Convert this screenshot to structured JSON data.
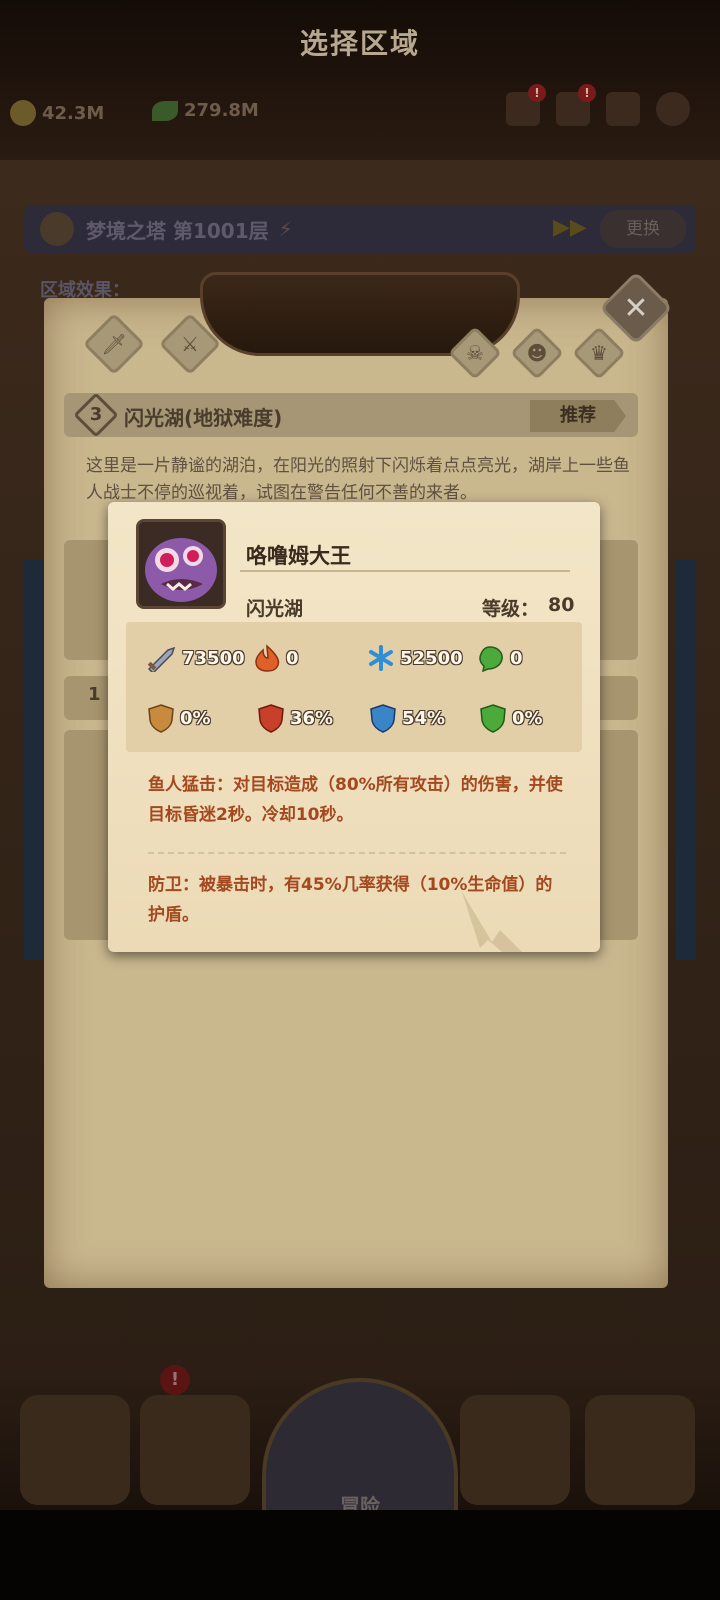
{
  "resources": {
    "gold": "42.3M",
    "leaf": "279.8M"
  },
  "tower": {
    "title": "梦境之塔 第1001层",
    "change": "更换",
    "region_effect": "区域效果："
  },
  "panel": {
    "title": "选择区域",
    "region": {
      "number": "3",
      "name": "闪光湖(地狱难度)",
      "recommend": "推荐",
      "description": "这里是一片静谧的湖泊，在阳光的照射下闪烁着点点亮光，湖岸上一些鱼人战士不停的巡视着，试图在警告任何不善的来者。"
    },
    "second_region_number": "1"
  },
  "boss": {
    "name": "咯噜姆大王",
    "region": "闪光湖",
    "level_label": "等级：",
    "level": "80",
    "stats": {
      "attack": "73500",
      "fire": "0",
      "ice": "52500",
      "poison": "0",
      "phys_res": "0%",
      "fire_res": "36%",
      "ice_res": "54%",
      "poison_res": "0%"
    },
    "skill1": "鱼人猛击：对目标造成（80%所有攻击）的伤害，并使目标昏迷2秒。冷却10秒。",
    "skill2": "防卫：被暴击时，有45%几率获得（10%生命值）的护盾。"
  },
  "bottom": {
    "adventure": "冒险"
  },
  "colors": {
    "parchment": "#f0e1c1",
    "skill_text": "#a4481e",
    "panel_title_bg": "#3b2818"
  }
}
